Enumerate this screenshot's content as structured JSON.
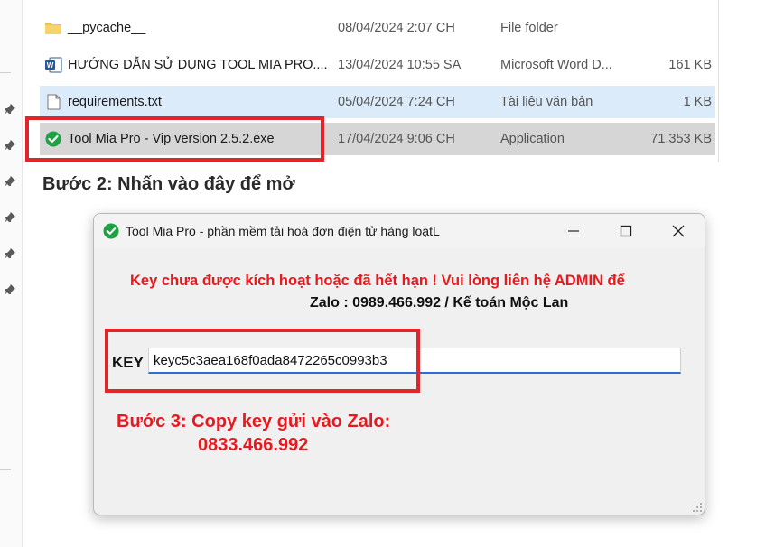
{
  "files": [
    {
      "name": "__pycache__",
      "date": "08/04/2024 2:07 CH",
      "type": "File folder",
      "size": "",
      "icon": "folder-icon",
      "state": "normal"
    },
    {
      "name": "HƯỚNG DẪN SỬ DỤNG TOOL MIA PRO....",
      "date": "13/04/2024 10:55 SA",
      "type": "Microsoft Word D...",
      "size": "161 KB",
      "icon": "word-document-icon",
      "state": "normal"
    },
    {
      "name": "requirements.txt",
      "date": "05/04/2024 7:24 CH",
      "type": "Tài liệu văn bản",
      "size": "1 KB",
      "icon": "text-file-icon",
      "state": "selected"
    },
    {
      "name": "Tool Mia Pro - Vip version 2.5.2.exe",
      "date": "17/04/2024 9:06 CH",
      "type": "Application",
      "size": "71,353 KB",
      "icon": "app-check-icon",
      "state": "highlighted"
    }
  ],
  "step2_text": "Bước 2: Nhấn vào đây để mở",
  "dialog": {
    "title": "Tool Mia Pro - phần mềm tải hoá đơn điện tử hàng loạtL",
    "warning": "Key chưa được kích hoạt hoặc đã hết hạn ! Vui lòng liên hệ ADMIN để",
    "contact": "Zalo : 0989.466.992 / Kế toán Mộc Lan",
    "key_label": "KEY",
    "key_value": "keyc5c3aea168f0ada8472265c0993b3"
  },
  "step3_line1": "Bước 3: Copy key gửi vào Zalo:",
  "step3_line2": "0833.466.992",
  "colors": {
    "accent_red": "#e0262b",
    "warning_red": "#e8191e",
    "selection_blue": "#dcebfa",
    "check_green": "#1fa246"
  }
}
